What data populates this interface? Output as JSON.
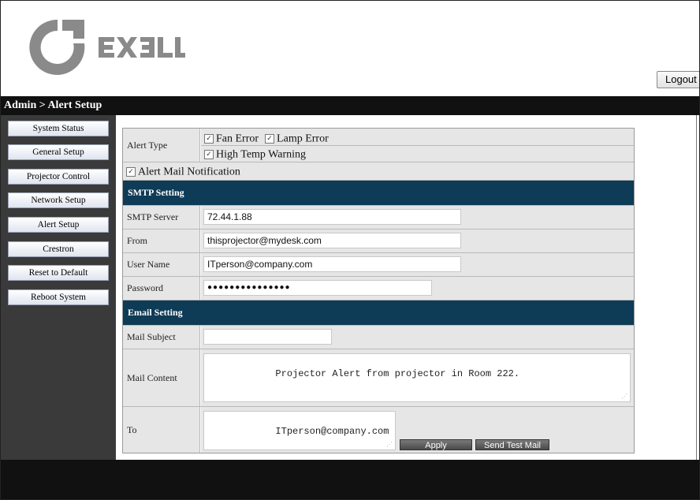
{
  "brand": {
    "name": "EXELL"
  },
  "header": {
    "logout_label": "Logout"
  },
  "breadcrumb": "Admin > Alert Setup",
  "sidebar": {
    "items": [
      {
        "label": "System Status"
      },
      {
        "label": "General Setup"
      },
      {
        "label": "Projector Control"
      },
      {
        "label": "Network Setup"
      },
      {
        "label": "Alert Setup"
      },
      {
        "label": "Crestron"
      },
      {
        "label": "Reset to Default"
      },
      {
        "label": "Reboot System"
      }
    ]
  },
  "alert_type": {
    "label": "Alert Type",
    "options": [
      {
        "label": "Fan Error",
        "checked": true
      },
      {
        "label": "Lamp Error",
        "checked": true
      },
      {
        "label": "High Temp Warning",
        "checked": true
      }
    ]
  },
  "alert_mail": {
    "label": "Alert Mail Notification",
    "checked": true
  },
  "smtp": {
    "title": "SMTP Setting",
    "server_label": "SMTP Server",
    "server_value": "72.44.1.88",
    "from_label": "From",
    "from_value": "thisprojector@mydesk.com",
    "username_label": "User Name",
    "username_value": "ITperson@company.com",
    "password_label": "Password",
    "password_value": "●●●●●●●●●●●●●●●"
  },
  "email": {
    "title": "Email Setting",
    "subject_label": "Mail Subject",
    "subject_value": "",
    "content_label": "Mail Content",
    "content_value": "Projector Alert from projector in Room 222.",
    "to_label": "To",
    "to_value": "ITperson@company.com",
    "apply_label": "Apply",
    "send_test_label": "Send Test Mail"
  },
  "colors": {
    "section_header": "#0e3b56",
    "sidebar_bg": "#3a3a3a",
    "topbar_bg": "#111111"
  }
}
